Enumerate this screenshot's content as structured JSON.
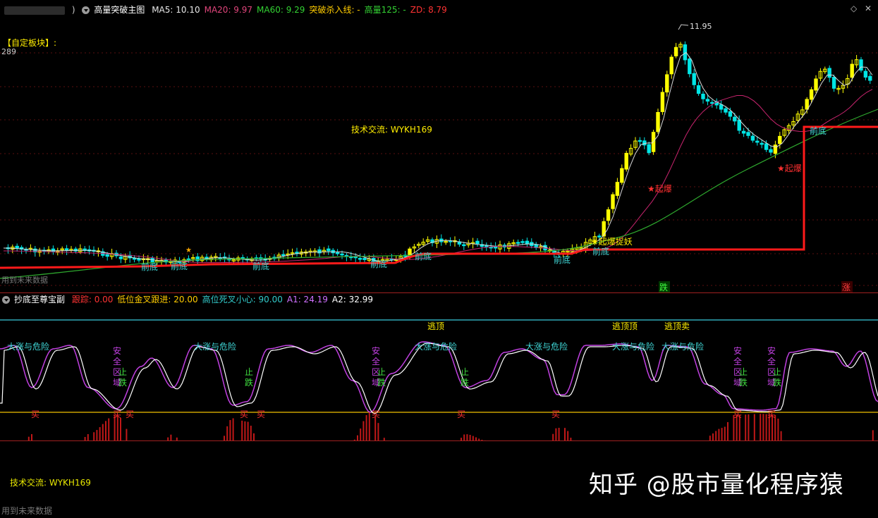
{
  "main_header": {
    "title": "高量突破主图",
    "indicators": [
      {
        "label": "MA5: 10.10",
        "color": "#e8e8e8"
      },
      {
        "label": "MA20: 9.97",
        "color": "#e0457b"
      },
      {
        "label": "MA60: 9.29",
        "color": "#33d233"
      },
      {
        "label": "突破杀入线: -",
        "color": "#ffcc00"
      },
      {
        "label": "高量125: -",
        "color": "#33d233"
      },
      {
        "label": "ZD: 8.79",
        "color": "#ff3333"
      }
    ]
  },
  "window_controls": {
    "restore": "◇",
    "close": "✕"
  },
  "main_panel": {
    "block_label": "【自定板块】:",
    "value_label": "289",
    "tech_label": "技术交流: WYKH169",
    "future_label": "用到未来数据",
    "high_value": "11.95",
    "signals_front": "前底",
    "signal_boom": "★起爆",
    "signal_boom_fly": "★起爆捉妖",
    "marker_die": "跌",
    "marker_zhang": "涨",
    "marker_dot": "★",
    "colors": {
      "up": "#ffff00",
      "down": "#00e5e5",
      "support": "#ff1a1a",
      "ma5": "#d8d8d8",
      "ma20": "#c8246e",
      "ma60": "#2ea82e"
    }
  },
  "sub_header": {
    "title": "抄底至尊宝副",
    "indicators": [
      {
        "label": "跟踪: 0.00",
        "color": "#ff3333"
      },
      {
        "label": "低位金叉跟进: 20.00",
        "color": "#ffcc00"
      },
      {
        "label": "高位死叉小心: 90.00",
        "color": "#33cccc"
      },
      {
        "label": "A1: 24.19",
        "color": "#d070ff"
      },
      {
        "label": "A2: 32.99",
        "color": "#ffffff"
      }
    ]
  },
  "sub_panel": {
    "danger": "大涨与危险",
    "escape": "逃顶",
    "escape_double": "逃顶顶",
    "escape_sell": "逃顶卖",
    "stop_fall": "止跌",
    "safe_zone": "安全区域",
    "buy": "买",
    "colors": {
      "fast": "#c040e0",
      "slow": "#ffffff",
      "bars": "#c01818",
      "low_line": "#c8a000",
      "high_line": "#30a8b8"
    }
  },
  "footer": {
    "tech_label": "技术交流: WYKH169",
    "future_label": "用到未来数据"
  },
  "watermark": "知乎 @股市量化程序猿",
  "chart_data": [
    {
      "type": "candlestick",
      "title": "高量突破主图",
      "series": [
        {
          "name": "MA5",
          "last": 10.1
        },
        {
          "name": "MA20",
          "last": 9.97
        },
        {
          "name": "MA60",
          "last": 9.29
        },
        {
          "name": "ZD",
          "last": 8.79
        }
      ],
      "max_label": 11.95
    },
    {
      "type": "line",
      "title": "抄底至尊宝副",
      "series": [
        {
          "name": "A1",
          "last": 24.19
        },
        {
          "name": "A2",
          "last": 32.99
        }
      ],
      "levels": [
        20.0,
        90.0
      ]
    }
  ]
}
